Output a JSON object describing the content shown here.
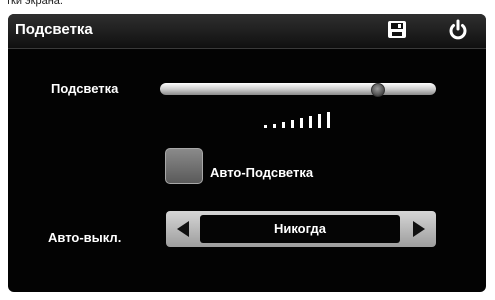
{
  "page_caption": "тки экрана.",
  "header": {
    "title": "Подсветка",
    "save_icon": "save-icon",
    "power_icon": "power-icon"
  },
  "backlight": {
    "label": "Подсветка",
    "level_fraction": 0.8
  },
  "auto_backlight": {
    "label": "Авто-Подсветка",
    "checked": false
  },
  "auto_off": {
    "label": "Авто-выкл.",
    "value": "Никогда",
    "left_icon": "arrow-left-icon",
    "right_icon": "arrow-right-icon"
  },
  "colors": {
    "background": "#030303",
    "text": "#ffffff",
    "control_gray": "#9d9d9d"
  }
}
